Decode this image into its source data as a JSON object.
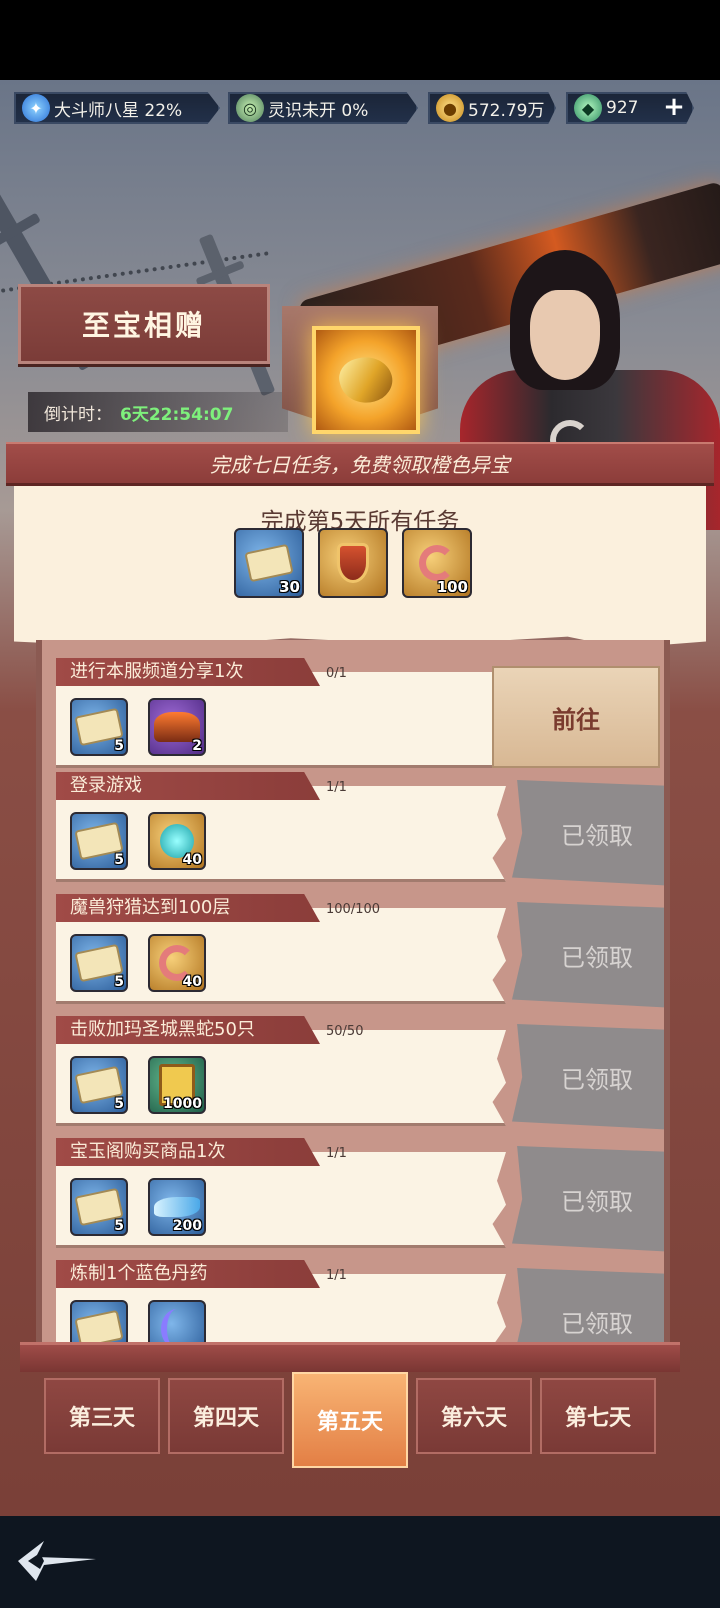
{
  "resources": {
    "rank": "大斗师八星 22%",
    "spirit": "灵识未开 0%",
    "coins": "572.79万",
    "jade": "927"
  },
  "event": {
    "title": "至宝相赠",
    "countdown_label": "倒计时：",
    "countdown_value": "6天22:54:07",
    "headline": "完成七日任务，免费领取橙色异宝"
  },
  "day_reward": {
    "title": "完成第5天所有任务",
    "items": [
      {
        "icon": "scroll-icon",
        "qty": "30"
      },
      {
        "icon": "shield-icon",
        "qty": ""
      },
      {
        "icon": "ring-icon",
        "qty": "100"
      }
    ]
  },
  "tasks": [
    {
      "label": "进行本服频道分享1次",
      "progress": "0/1",
      "rewards": [
        {
          "icon": "scroll-icon",
          "qty": "5"
        },
        {
          "icon": "altar-icon",
          "qty": "2"
        }
      ],
      "action": "前往"
    },
    {
      "label": "登录游戏",
      "progress": "1/1",
      "rewards": [
        {
          "icon": "scroll-icon",
          "qty": "5"
        },
        {
          "icon": "sphere-icon",
          "qty": "40"
        }
      ],
      "action": "已领取"
    },
    {
      "label": "魔兽狩猎达到100层",
      "progress": "100/100",
      "rewards": [
        {
          "icon": "scroll-icon",
          "qty": "5"
        },
        {
          "icon": "ring-icon",
          "qty": "40"
        }
      ],
      "action": "已领取"
    },
    {
      "label": "击败加玛圣城黑蛇50只",
      "progress": "50/50",
      "rewards": [
        {
          "icon": "scroll-icon",
          "qty": "5"
        },
        {
          "icon": "book-icon",
          "qty": "1000"
        }
      ],
      "action": "已领取"
    },
    {
      "label": "宝玉阁购买商品1次",
      "progress": "1/1",
      "rewards": [
        {
          "icon": "scroll-icon",
          "qty": "5"
        },
        {
          "icon": "fish-icon",
          "qty": "200"
        }
      ],
      "action": "已领取"
    },
    {
      "label": "炼制1个蓝色丹药",
      "progress": "1/1",
      "rewards": [
        {
          "icon": "scroll-icon",
          "qty": ""
        },
        {
          "icon": "claw-icon",
          "qty": ""
        }
      ],
      "action": "已领取"
    }
  ],
  "tabs": [
    {
      "label": "第三天",
      "active": false
    },
    {
      "label": "第四天",
      "active": false
    },
    {
      "label": "第五天",
      "active": true
    },
    {
      "label": "第六天",
      "active": false
    },
    {
      "label": "第七天",
      "active": false
    }
  ],
  "plus_label": "+"
}
